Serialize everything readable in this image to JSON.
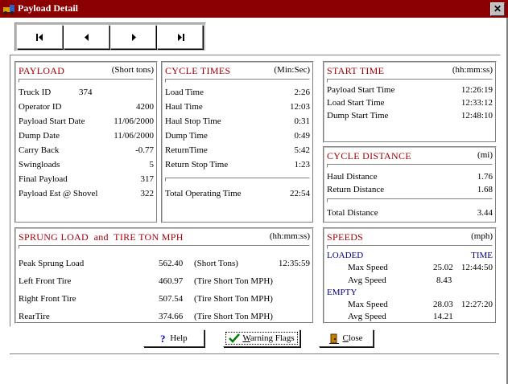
{
  "window": {
    "title": "Payload Detail",
    "close_glyph": "✕"
  },
  "nav": {
    "first": "first-record",
    "prev": "previous-record",
    "next": "next-record",
    "last": "last-record"
  },
  "payload": {
    "header": "PAYLOAD",
    "unit": "(Short tons)",
    "truck_id_label": "Truck ID",
    "truck_id": "374",
    "rows": [
      {
        "label": "Operator ID",
        "value": "4200"
      },
      {
        "label": "Payload Start Date",
        "value": "11/06/2000"
      },
      {
        "label": "Dump Date",
        "value": "11/06/2000"
      },
      {
        "label": "Carry Back",
        "value": "-0.77"
      },
      {
        "label": "Swingloads",
        "value": "5"
      },
      {
        "label": "Final Payload",
        "value": "317"
      },
      {
        "label": "Payload Est @ Shovel",
        "value": "322"
      }
    ]
  },
  "cycle_times": {
    "header": "CYCLE TIMES",
    "unit": "(Min:Sec)",
    "rows": [
      {
        "label": "Load Time",
        "value": "2:26"
      },
      {
        "label": "Haul Time",
        "value": "12:03"
      },
      {
        "label": "Haul Stop Time",
        "value": "0:31"
      },
      {
        "label": "Dump Time",
        "value": "0:49"
      },
      {
        "label": "ReturnTime",
        "value": "5:42"
      },
      {
        "label": "Return Stop Time",
        "value": "1:23"
      }
    ],
    "total_label": "Total Operating Time",
    "total_value": "22:54"
  },
  "start_time": {
    "header": "START TIME",
    "unit": "(hh:mm:ss)",
    "rows": [
      {
        "label": "Payload Start Time",
        "value": "12:26:19"
      },
      {
        "label": "Load Start Time",
        "value": "12:33:12"
      },
      {
        "label": "Dump Start Time",
        "value": "12:48:10"
      }
    ]
  },
  "cycle_distance": {
    "header": "CYCLE DISTANCE",
    "unit": "(mi)",
    "rows": [
      {
        "label": "Haul Distance",
        "value": "1.76"
      },
      {
        "label": "Return Distance",
        "value": "1.68"
      }
    ],
    "total_label": "Total Distance",
    "total_value": "3.44"
  },
  "sprung": {
    "header": "SPRUNG LOAD  and  TIRE TON MPH",
    "unit": "(hh:mm:ss)",
    "rows": [
      {
        "label": "Peak Sprung Load",
        "value": "562.40",
        "unit": "(Short Tons)",
        "time": "12:35:59"
      },
      {
        "label": "Left Front Tire",
        "value": "460.97",
        "unit": "(Tire Short Ton MPH)",
        "time": ""
      },
      {
        "label": "Right Front Tire",
        "value": "507.54",
        "unit": "(Tire Short Ton MPH)",
        "time": ""
      },
      {
        "label": "RearTire",
        "value": "374.66",
        "unit": "(Tire Short Ton MPH)",
        "time": ""
      }
    ]
  },
  "speeds": {
    "header": "SPEEDS",
    "unit": "(mph)",
    "loaded_label": "LOADED",
    "time_label": "TIME",
    "loaded_max_label": "Max Speed",
    "loaded_max": "25.02",
    "loaded_max_time": "12:44:50",
    "loaded_avg_label": "Avg Speed",
    "loaded_avg": "8.43",
    "empty_label": "EMPTY",
    "empty_max_label": "Max Speed",
    "empty_max": "28.03",
    "empty_max_time": "12:27:20",
    "empty_avg_label": "Avg Speed",
    "empty_avg": "14.21"
  },
  "buttons": {
    "help": "Help",
    "help_icon": "question-mark",
    "warning_prefix": "W",
    "warning_rest": "arning Flags",
    "warning_icon": "checkmark",
    "close_prefix": "C",
    "close_rest": "lose",
    "close_icon": "door-exit"
  },
  "colors": {
    "titlebar": "#8b0000",
    "header_text": "#a0000a",
    "help_icon": "#0000c0",
    "check_icon": "#008000"
  }
}
